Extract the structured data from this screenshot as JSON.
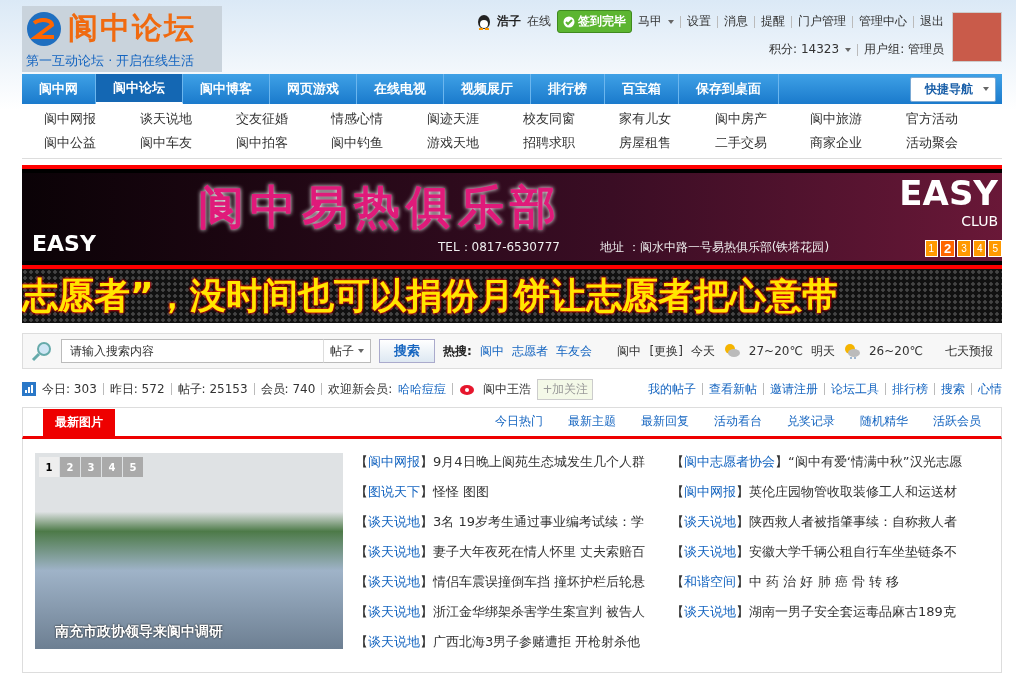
{
  "header": {
    "logo_title": "阆中论坛",
    "slogan": "第一互动论坛 · 开启在线生活"
  },
  "user": {
    "name": "浩子",
    "status": "在线",
    "checkin": "签到完毕",
    "menu": "马甲",
    "links": [
      "设置",
      "消息",
      "提醒",
      "门户管理",
      "管理中心",
      "退出"
    ],
    "points": "积分: 14323",
    "group": "用户组: 管理员"
  },
  "nav": {
    "items": [
      {
        "label": "阆中网",
        "selected": false
      },
      {
        "label": "阆中论坛",
        "selected": true
      },
      {
        "label": "阆中博客",
        "selected": false
      },
      {
        "label": "网页游戏",
        "selected": false
      },
      {
        "label": "在线电视",
        "selected": false
      },
      {
        "label": "视频展厅",
        "selected": false
      },
      {
        "label": "排行榜",
        "selected": false
      },
      {
        "label": "百宝箱",
        "selected": false
      },
      {
        "label": "保存到桌面",
        "selected": false
      }
    ],
    "quick_nav": "快捷导航"
  },
  "subnav": [
    "阆中网报",
    "谈天说地",
    "交友征婚",
    "情感心情",
    "阆迹天涯",
    "校友同窗",
    "家有儿女",
    "阆中房产",
    "阆中旅游",
    "官方活动",
    "阆中公益",
    "阆中车友",
    "阆中拍客",
    "阆中钓鱼",
    "游戏天地",
    "招聘求职",
    "房屋租售",
    "二手交易",
    "商家企业",
    "活动聚会"
  ],
  "banner": {
    "brand": "EASY",
    "title": "阆中易热俱乐部",
    "tel": "TEL：0817-6530777",
    "address": "地址 ：阆水中路一号易热俱乐部(铁塔花园)",
    "sign": "EASY",
    "sign_sub": "CLUB",
    "pager": [
      {
        "label": "1",
        "selected": false
      },
      {
        "label": "2",
        "selected": true
      },
      {
        "label": "3",
        "selected": false
      },
      {
        "label": "4",
        "selected": false
      },
      {
        "label": "5",
        "selected": false
      }
    ]
  },
  "ticker": "志愿者”，没时间也可以捐份月饼让志愿者把心意带",
  "search": {
    "placeholder": "请输入搜索内容",
    "scope": "帖子",
    "button": "搜索",
    "hot_label": "热搜:",
    "hot": [
      "阆中",
      "志愿者",
      "车友会"
    ],
    "city": "阆中",
    "change": "[更换]",
    "today_label": "今天",
    "today_temp": "27~20℃",
    "tomorrow_label": "明天",
    "tomorrow_temp": "26~20℃",
    "forecast": "七天预报"
  },
  "stats": {
    "items": [
      "今日: 303",
      "昨日: 572",
      "帖子: 25153",
      "会员: 740"
    ],
    "welcome": "欢迎新会员:",
    "new_member": "哈哈痘痘",
    "weibo": "阆中王浩",
    "follow": "+加关注",
    "links": [
      "我的帖子",
      "查看新帖",
      "邀请注册",
      "论坛工具",
      "排行榜",
      "搜索",
      "心情"
    ]
  },
  "tabs": {
    "title": "最新图片",
    "items": [
      "今日热门",
      "最新主题",
      "最新回复",
      "活动看台",
      "兑奖记录",
      "随机精华",
      "活跃会员"
    ]
  },
  "photo": {
    "caption": "南充市政协领导来阆中调研",
    "pager": [
      {
        "label": "1",
        "selected": true
      },
      {
        "label": "2",
        "selected": false
      },
      {
        "label": "3",
        "selected": false
      },
      {
        "label": "4",
        "selected": false
      },
      {
        "label": "5",
        "selected": false
      }
    ]
  },
  "news_left": [
    {
      "open": "【",
      "category": "阆中网报",
      "close": "】",
      "title": "9月4日晚上阆苑生态城发生几个人群"
    },
    {
      "open": "【",
      "category": "图说天下",
      "close": "】",
      "title": "怪怪 图图"
    },
    {
      "open": "【",
      "category": "谈天说地",
      "close": "】",
      "title": "3名 19岁考生通过事业编考试续：学"
    },
    {
      "open": "【",
      "category": "谈天说地",
      "close": "】",
      "title": "妻子大年夜死在情人怀里 丈夫索赔百"
    },
    {
      "open": "【",
      "category": "谈天说地",
      "close": "】",
      "title": "情侣车震误撞倒车挡 撞坏护栏后轮悬"
    },
    {
      "open": "【",
      "category": "谈天说地",
      "close": "】",
      "title": "浙江金华绑架杀害学生案宣判 被告人"
    },
    {
      "open": "【",
      "category": "谈天说地",
      "close": "】",
      "title": "广西北海3男子参赌遭拒 开枪射杀他"
    }
  ],
  "news_right": [
    {
      "open": "【",
      "category": "阆中志愿者协会",
      "close": "】",
      "title": "“阆中有爱‘情满中秋”汉光志愿"
    },
    {
      "open": "【",
      "category": "阆中网报",
      "close": "】",
      "title": "英伦庄园物管收取装修工人和运送材"
    },
    {
      "open": "【",
      "category": "谈天说地",
      "close": "】",
      "title": "陕西救人者被指肇事续：自称救人者"
    },
    {
      "open": "【",
      "category": "谈天说地",
      "close": "】",
      "title": "安徽大学千辆公租自行车坐垫链条不"
    },
    {
      "open": "【",
      "category": "和谐空间",
      "close": "】",
      "title": "中 药 治 好 肺 癌 骨 转 移"
    },
    {
      "open": "【",
      "category": "谈天说地",
      "close": "】",
      "title": "湖南一男子安全套运毒品麻古189克"
    }
  ]
}
